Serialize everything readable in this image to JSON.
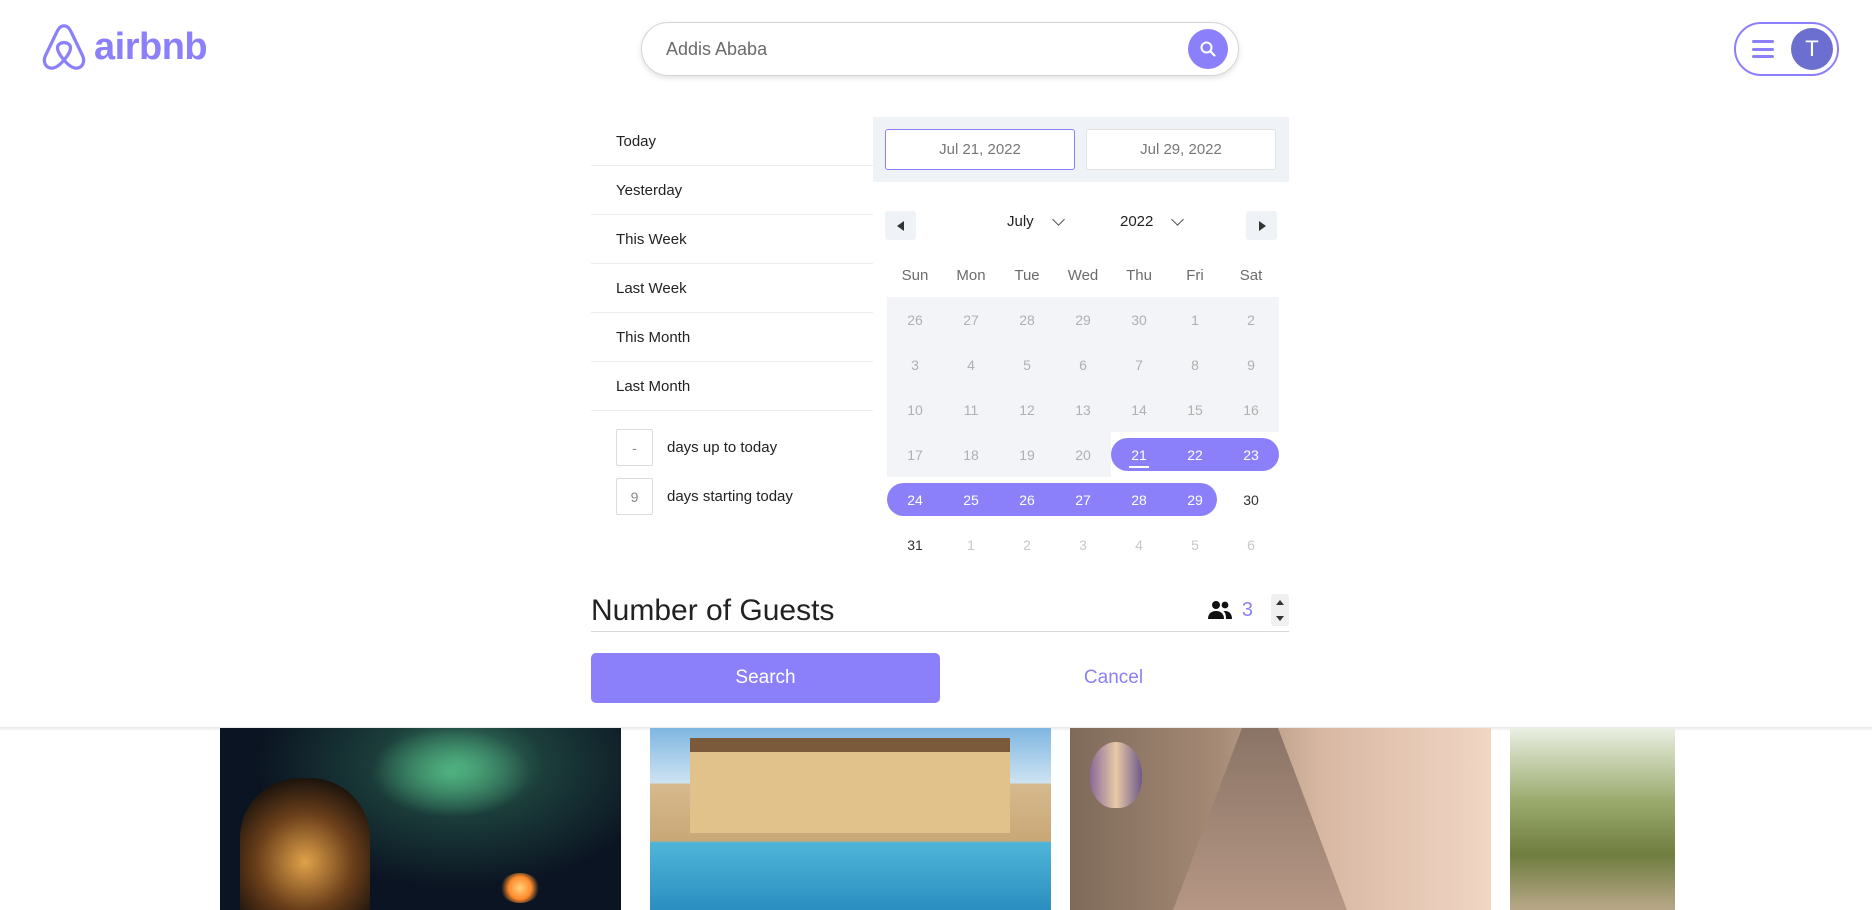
{
  "brand": {
    "name": "airbnb",
    "color": "#8b80f9"
  },
  "search": {
    "placeholder": "Addis Ababa",
    "value": ""
  },
  "user": {
    "initial": "T"
  },
  "presets": {
    "items": [
      "Today",
      "Yesterday",
      "This Week",
      "Last Week",
      "This Month",
      "Last Month"
    ],
    "days_up_value": "-",
    "days_up_label": "days up to today",
    "days_start_value": "9",
    "days_start_label": "days starting today"
  },
  "calendar": {
    "start_date": "Jul 21, 2022",
    "end_date": "Jul 29, 2022",
    "month": "July",
    "year": "2022",
    "weekdays": [
      "Sun",
      "Mon",
      "Tue",
      "Wed",
      "Thu",
      "Fri",
      "Sat"
    ],
    "weeks": [
      [
        "26",
        "27",
        "28",
        "29",
        "30",
        "1",
        "2"
      ],
      [
        "3",
        "4",
        "5",
        "6",
        "7",
        "8",
        "9"
      ],
      [
        "10",
        "11",
        "12",
        "13",
        "14",
        "15",
        "16"
      ],
      [
        "17",
        "18",
        "19",
        "20",
        "21",
        "22",
        "23"
      ],
      [
        "24",
        "25",
        "26",
        "27",
        "28",
        "29",
        "30"
      ],
      [
        "31",
        "1",
        "2",
        "3",
        "4",
        "5",
        "6"
      ]
    ],
    "range_start": "21",
    "range_end": "29",
    "today": "21"
  },
  "guests": {
    "title": "Number of Guests",
    "count": "3"
  },
  "actions": {
    "search": "Search",
    "cancel": "Cancel"
  }
}
